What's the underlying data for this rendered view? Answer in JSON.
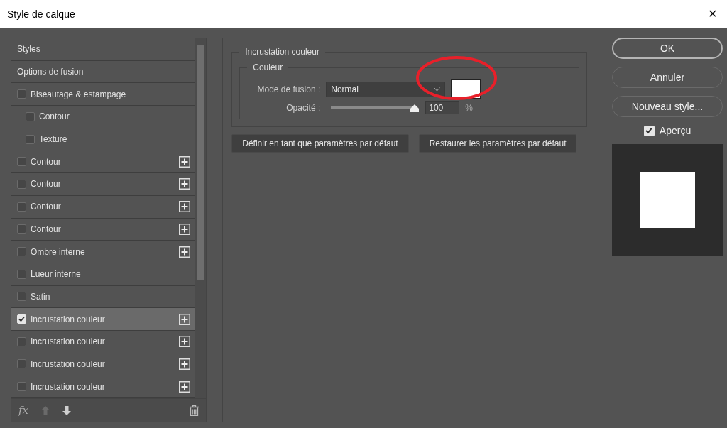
{
  "window": {
    "title": "Style de calque",
    "close": "✕"
  },
  "styles_list": {
    "items": [
      {
        "kind": "header",
        "label": "Styles",
        "selected": false
      },
      {
        "kind": "header",
        "label": "Options de fusion",
        "selected": false
      },
      {
        "kind": "check",
        "label": "Biseautage & estampage",
        "checked": false,
        "selected": false,
        "addable": false,
        "children": [
          {
            "kind": "check",
            "label": "Contour",
            "checked": false,
            "selected": false,
            "addable": false
          },
          {
            "kind": "check",
            "label": "Texture",
            "checked": false,
            "selected": false,
            "addable": false
          }
        ]
      },
      {
        "kind": "check",
        "label": "Contour",
        "checked": false,
        "selected": false,
        "addable": true
      },
      {
        "kind": "check",
        "label": "Contour",
        "checked": false,
        "selected": false,
        "addable": true
      },
      {
        "kind": "check",
        "label": "Contour",
        "checked": false,
        "selected": false,
        "addable": true
      },
      {
        "kind": "check",
        "label": "Contour",
        "checked": false,
        "selected": false,
        "addable": true
      },
      {
        "kind": "check",
        "label": "Ombre interne",
        "checked": false,
        "selected": false,
        "addable": true
      },
      {
        "kind": "check",
        "label": "Lueur interne",
        "checked": false,
        "selected": false,
        "addable": false
      },
      {
        "kind": "check",
        "label": "Satin",
        "checked": false,
        "selected": false,
        "addable": false
      },
      {
        "kind": "check",
        "label": "Incrustation couleur",
        "checked": true,
        "selected": true,
        "addable": true
      },
      {
        "kind": "check",
        "label": "Incrustation couleur",
        "checked": false,
        "selected": false,
        "addable": true
      },
      {
        "kind": "check",
        "label": "Incrustation couleur",
        "checked": false,
        "selected": false,
        "addable": true
      },
      {
        "kind": "check",
        "label": "Incrustation couleur",
        "checked": false,
        "selected": false,
        "addable": true
      }
    ],
    "footer": {
      "fx": "fx"
    }
  },
  "settings": {
    "title": "Incrustation couleur",
    "group": "Couleur",
    "blend_mode": {
      "label": "Mode de fusion :",
      "value": "Normal",
      "color": "#ffffff"
    },
    "opacity": {
      "label": "Opacité :",
      "level": 1,
      "value": "100",
      "unit": "%"
    },
    "buttons": [
      "Définir en tant que paramètres par défaut",
      "Restaurer les paramètres par défaut"
    ]
  },
  "actions": {
    "buttons": [
      {
        "label": "OK",
        "default": true
      },
      {
        "label": "Annuler",
        "default": false
      },
      {
        "label": "Nouveau style...",
        "default": false
      }
    ],
    "preview": {
      "label": "Aperçu",
      "checked": true
    }
  }
}
